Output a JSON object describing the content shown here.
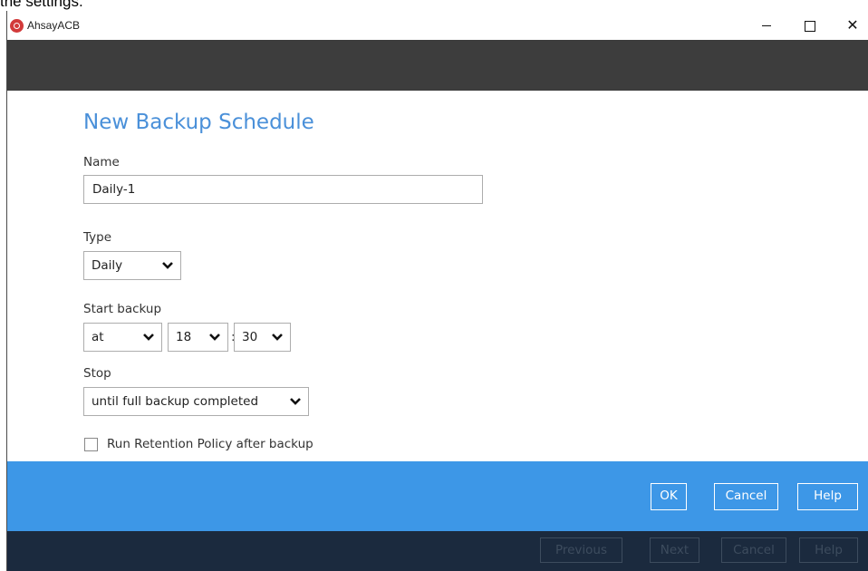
{
  "caption": "the settings.",
  "window": {
    "title": "AhsayACB",
    "minimize_label": "–",
    "maximize_label": "□",
    "close_label": "✕"
  },
  "form": {
    "heading": "New Backup Schedule",
    "name_label": "Name",
    "name_value": "Daily-1",
    "type_label": "Type",
    "type_value": "Daily",
    "start_label": "Start backup",
    "start_at": "at",
    "start_hour": "18",
    "start_separator": ":",
    "start_minute": "30",
    "stop_label": "Stop",
    "stop_value": "until full backup completed",
    "retention_label": "Run Retention Policy after backup",
    "retention_checked": false
  },
  "dialog_buttons": {
    "ok": "OK",
    "cancel": "Cancel",
    "help": "Help"
  },
  "wizard_buttons": {
    "previous": "Previous",
    "next": "Next",
    "cancel": "Cancel",
    "help": "Help"
  },
  "colors": {
    "heading": "#4a90d9",
    "action_bar": "#3d97e7",
    "nav_bar": "#1b2a3e",
    "header_bar": "#3d3d3d"
  },
  "icons": {
    "app": "ahsay-logo-icon",
    "dropdown": "chevron-down-icon"
  }
}
